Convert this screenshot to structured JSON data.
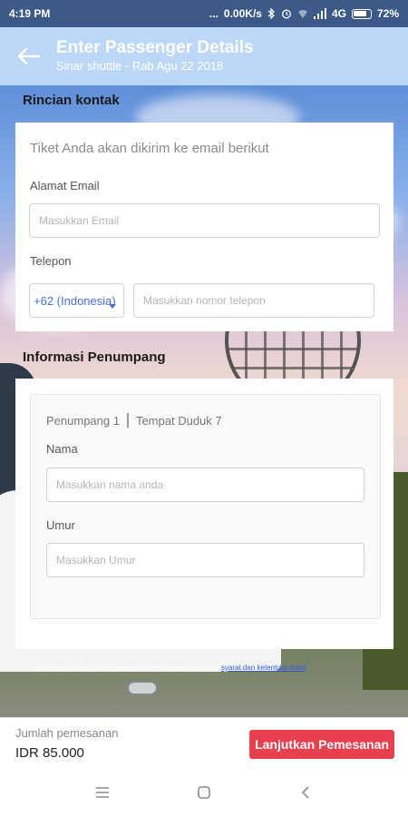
{
  "status_bar": {
    "time": "4:19 PM",
    "dots": "...",
    "network_speed": "0.00K/s",
    "network_type": "4G",
    "battery": "72%"
  },
  "header": {
    "title": "Enter Passenger Details",
    "subtitle": "Sinar shuttle - Rab Agu 22 2018",
    "back_icon": "arrow-left-icon"
  },
  "contact": {
    "heading": "Rincian kontak",
    "info": "Tiket Anda akan dikirim ke email berikut",
    "email_label": "Alamat Email",
    "email_placeholder": "Masukkan Email",
    "phone_label": "Telepon",
    "country_code": "+62 (Indonesia)",
    "phone_placeholder": "Masukkan nomor telepon"
  },
  "passenger": {
    "heading": "Informasi Penumpang",
    "passenger_label": "Penumpang 1",
    "seat_label": "Tempat Duduk 7",
    "name_label": "Nama",
    "name_placeholder": "Masukkan nama anda",
    "age_label": "Umur",
    "age_placeholder": "Masukkan Umur"
  },
  "terms": {
    "prefix": "Saat mengklik lanjutkan pemesanan, Anda setuju dengan ",
    "link": "syarat dan ketentuan kami"
  },
  "footer": {
    "total_label": "Jumlah pemesanan",
    "total_amount": "IDR 85.000",
    "cta_label": "Lanjutkan Pemesanan"
  },
  "colors": {
    "status_bar": "#3c5a88",
    "header": "#bcd8f6",
    "cta": "#e8404f",
    "link": "#2f5fe0"
  }
}
